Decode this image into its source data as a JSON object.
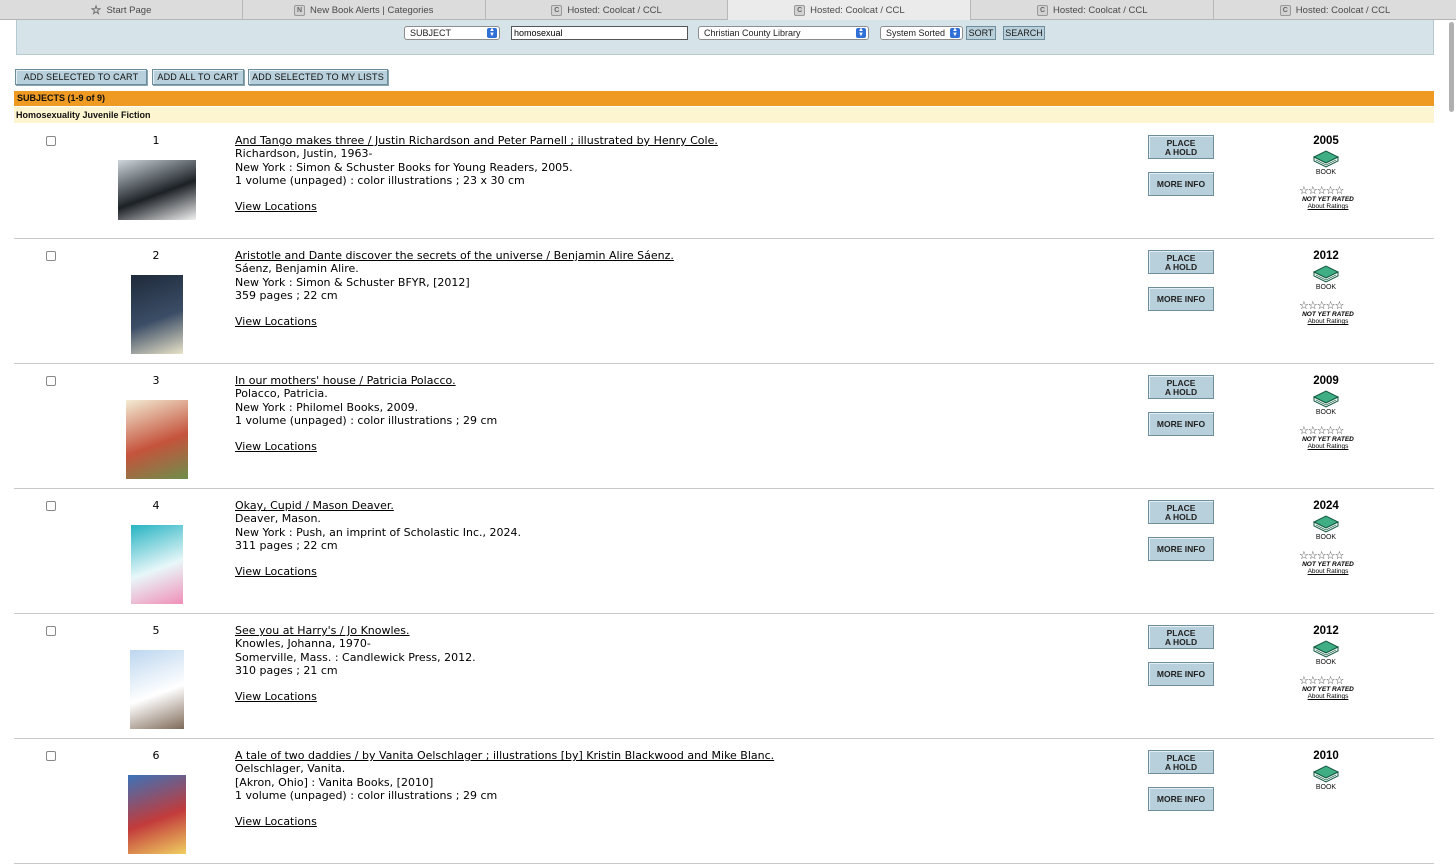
{
  "tabs": [
    {
      "label": "Start Page",
      "icon": "star-icon",
      "glyph": "☆"
    },
    {
      "label": "New Book Alerts | Categories",
      "icon": "n-favicon",
      "glyph": "N"
    },
    {
      "label": "Hosted: Coolcat / CCL",
      "icon": "c-favicon",
      "glyph": "C"
    },
    {
      "label": "Hosted: Coolcat / CCL",
      "icon": "c-favicon",
      "glyph": "C"
    },
    {
      "label": "Hosted: Coolcat / CCL",
      "icon": "c-favicon",
      "glyph": "C"
    },
    {
      "label": "Hosted: Coolcat / CCL",
      "icon": "c-favicon",
      "glyph": "C"
    }
  ],
  "search": {
    "type_select": "SUBJECT",
    "query": "homosexual",
    "library_select": "Christian County Library",
    "sort_select": "System Sorted",
    "sort_button": "SORT",
    "search_button": "SEARCH"
  },
  "actions": {
    "add_selected_cart": "ADD SELECTED TO CART",
    "add_all_cart": "ADD ALL TO CART",
    "add_selected_lists": "ADD SELECTED TO MY LISTS"
  },
  "results_header": "SUBJECTS (1-9 of 9)",
  "subject_heading": "Homosexuality Juvenile Fiction",
  "labels": {
    "place_hold": "PLACE\nA HOLD",
    "more_info": "MORE INFO",
    "view_locations": "View Locations",
    "format": "BOOK",
    "not_rated": "NOT YET RATED",
    "about_ratings": "About Ratings",
    "stars": "☆☆☆☆☆"
  },
  "results": [
    {
      "num": "1",
      "title": "And Tango makes three / Justin Richardson and Peter Parnell ; illustrated by Henry Cole.",
      "author": "Richardson, Justin, 1963-",
      "publisher": "New York : Simon & Schuster Books for Young Readers, 2005.",
      "description": "1 volume (unpaged) : color illustrations ; 23 x 30 cm",
      "year": "2005",
      "cover_colors": [
        "#cfd8de",
        "#1c2126",
        "#f2f2f2"
      ]
    },
    {
      "num": "2",
      "title": "Aristotle and Dante discover the secrets of the universe / Benjamin Alire Sáenz.",
      "author": "Sáenz, Benjamin Alire.",
      "publisher": "New York : Simon & Schuster BFYR, [2012]",
      "description": "359 pages ; 22 cm",
      "year": "2012",
      "cover_colors": [
        "#1e2a3a",
        "#3b4d66",
        "#e9e3c9"
      ]
    },
    {
      "num": "3",
      "title": "In our mothers' house / Patricia Polacco.",
      "author": "Polacco, Patricia.",
      "publisher": "New York : Philomel Books, 2009.",
      "description": "1 volume (unpaged) : color illustrations ; 29 cm",
      "year": "2009",
      "cover_colors": [
        "#f3ecd4",
        "#c5533c",
        "#6d8e4b"
      ]
    },
    {
      "num": "4",
      "title": "Okay, Cupid / Mason Deaver.",
      "author": "Deaver, Mason.",
      "publisher": "New York : Push, an imprint of Scholastic Inc., 2024.",
      "description": "311 pages ; 22 cm",
      "year": "2024",
      "cover_colors": [
        "#26b3c2",
        "#e8f7f9",
        "#f08fb8"
      ]
    },
    {
      "num": "5",
      "title": "See you at Harry's / Jo Knowles.",
      "author": "Knowles, Johanna, 1970-",
      "publisher": "Somerville, Mass. : Candlewick Press, 2012.",
      "description": "310 pages ; 21 cm",
      "year": "2012",
      "cover_colors": [
        "#bcd6ef",
        "#ffffff",
        "#7f6a58"
      ]
    },
    {
      "num": "6",
      "title": "A tale of two daddies / by Vanita Oelschlager ; illustrations [by] Kristin Blackwood and Mike Blanc.",
      "author": "Oelschlager, Vanita.",
      "publisher": "[Akron, Ohio] : Vanita Books, [2010]",
      "description": "1 volume (unpaged) : color illustrations ; 29 cm",
      "year": "2010",
      "cover_colors": [
        "#3b73b9",
        "#c23b3b",
        "#f0d060"
      ]
    }
  ],
  "colors": {
    "orange_header": "#ef9a22",
    "yellow_header": "#fdf5d0",
    "button_blue": "#b8d0db",
    "search_strip": "#d6e4ea",
    "book_icon_green": "#2c8a66"
  }
}
